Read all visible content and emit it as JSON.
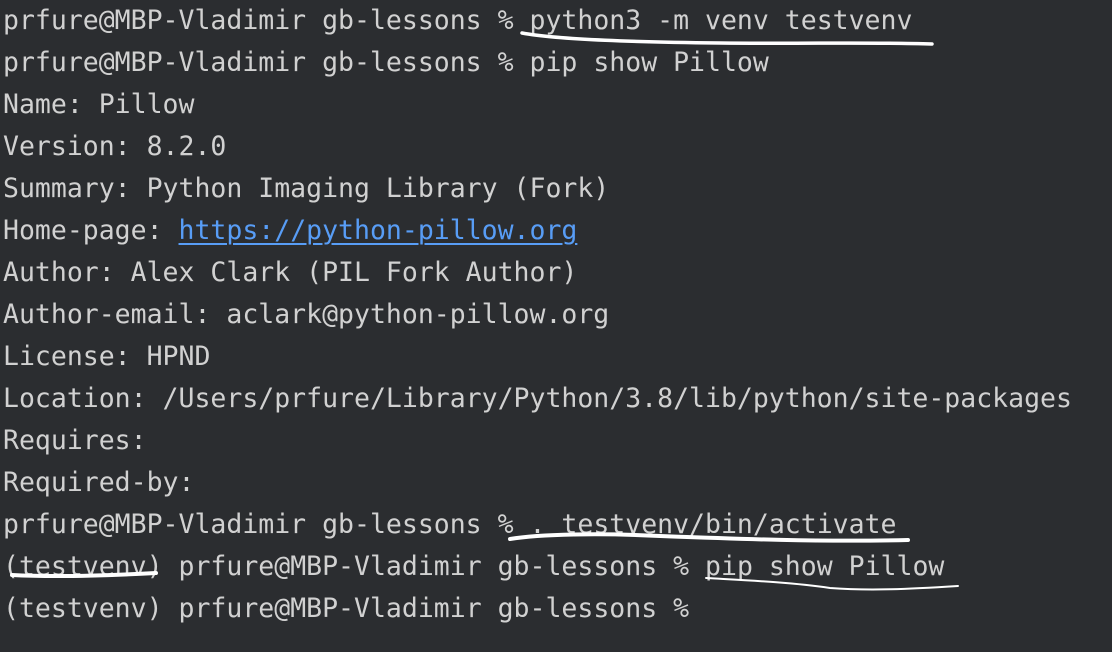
{
  "terminal": {
    "prompt": "prfure@MBP-Vladimir gb-lessons %",
    "venv_tag": "(testvenv)",
    "lines": [
      {
        "kind": "cmd",
        "prompt": "prfure@MBP-Vladimir gb-lessons %",
        "command": "python3 -m venv testvenv"
      },
      {
        "kind": "cmd",
        "prompt": "prfure@MBP-Vladimir gb-lessons %",
        "command": "pip show Pillow"
      },
      {
        "kind": "out",
        "text": "Name: Pillow"
      },
      {
        "kind": "out",
        "text": "Version: 8.2.0"
      },
      {
        "kind": "out",
        "text": "Summary: Python Imaging Library (Fork)"
      },
      {
        "kind": "link",
        "label": "Home-page:",
        "url": "https://python-pillow.org"
      },
      {
        "kind": "out",
        "text": "Author: Alex Clark (PIL Fork Author)"
      },
      {
        "kind": "out",
        "text": "Author-email: aclark@python-pillow.org"
      },
      {
        "kind": "out",
        "text": "License: HPND"
      },
      {
        "kind": "out",
        "text": "Location: /Users/prfure/Library/Python/3.8/lib/python/site-packages"
      },
      {
        "kind": "out",
        "text": "Requires:"
      },
      {
        "kind": "out",
        "text": "Required-by:"
      },
      {
        "kind": "cmd",
        "prompt": "prfure@MBP-Vladimir gb-lessons %",
        "command": ". testvenv/bin/activate"
      },
      {
        "kind": "venvcmd",
        "venv": "(testvenv)",
        "prompt": "prfure@MBP-Vladimir gb-lessons %",
        "command": "pip show Pillow"
      },
      {
        "kind": "venvcmd",
        "venv": "(testvenv)",
        "prompt": "prfure@MBP-Vladimir gb-lessons %",
        "command": ""
      }
    ]
  },
  "colors": {
    "background": "#2b2d30",
    "text": "#d1d1d1",
    "link": "#589df6",
    "annotation": "#ffffff"
  }
}
